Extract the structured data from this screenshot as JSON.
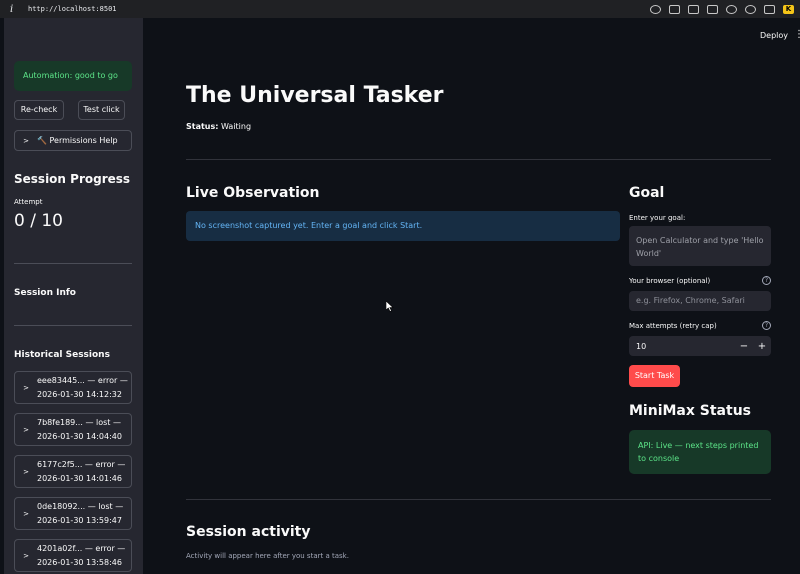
{
  "browser": {
    "info_icon": "i",
    "url": "http://localhost:8501"
  },
  "sidebar": {
    "automation_status": "Automation: good to go",
    "recheck_label": "Re-check",
    "testclick_label": "Test click",
    "permissions_label": "🔨 Permissions Help",
    "progress_title": "Session Progress",
    "attempt_label": "Attempt",
    "attempt_value": "0 / 10",
    "info_title": "Session Info",
    "historical_title": "Historical Sessions",
    "sessions": [
      {
        "line1": "eee83445... — error —",
        "line2": "2026-01-30 14:12:32"
      },
      {
        "line1": "7b8fe189... — lost —",
        "line2": "2026-01-30 14:04:40"
      },
      {
        "line1": "6177c2f5... — error —",
        "line2": "2026-01-30 14:01:46"
      },
      {
        "line1": "0de18092... — lost —",
        "line2": "2026-01-30 13:59:47"
      },
      {
        "line1": "4201a02f... — error —",
        "line2": "2026-01-30 13:58:46"
      }
    ]
  },
  "header": {
    "deploy_label": "Deploy",
    "menu_icon": "⋮"
  },
  "main": {
    "title": "The Universal Tasker",
    "status_label": "Status:",
    "status_value": "Waiting",
    "live_title": "Live Observation",
    "live_info": "No screenshot captured yet. Enter a goal and click Start.",
    "session_activity_title": "Session activity",
    "session_activity_caption": "Activity will appear here after you start a task."
  },
  "goal": {
    "title": "Goal",
    "goal_label": "Enter your goal:",
    "goal_placeholder": "Open Calculator and type 'Hello World'",
    "browser_label": "Your browser (optional)",
    "browser_placeholder": "e.g. Firefox, Chrome, Safari",
    "attempts_label": "Max attempts (retry cap)",
    "attempts_value": "10",
    "minus": "−",
    "plus": "+",
    "start_label": "Start Task"
  },
  "minimax": {
    "title": "MiniMax Status",
    "status": "API: Live — next steps printed to console"
  },
  "colors": {
    "accent": "#ff4b4b",
    "success_bg": "#173928",
    "success_text": "#5ce488",
    "info_bg": "#172d43",
    "info_text": "#64b5f6"
  }
}
